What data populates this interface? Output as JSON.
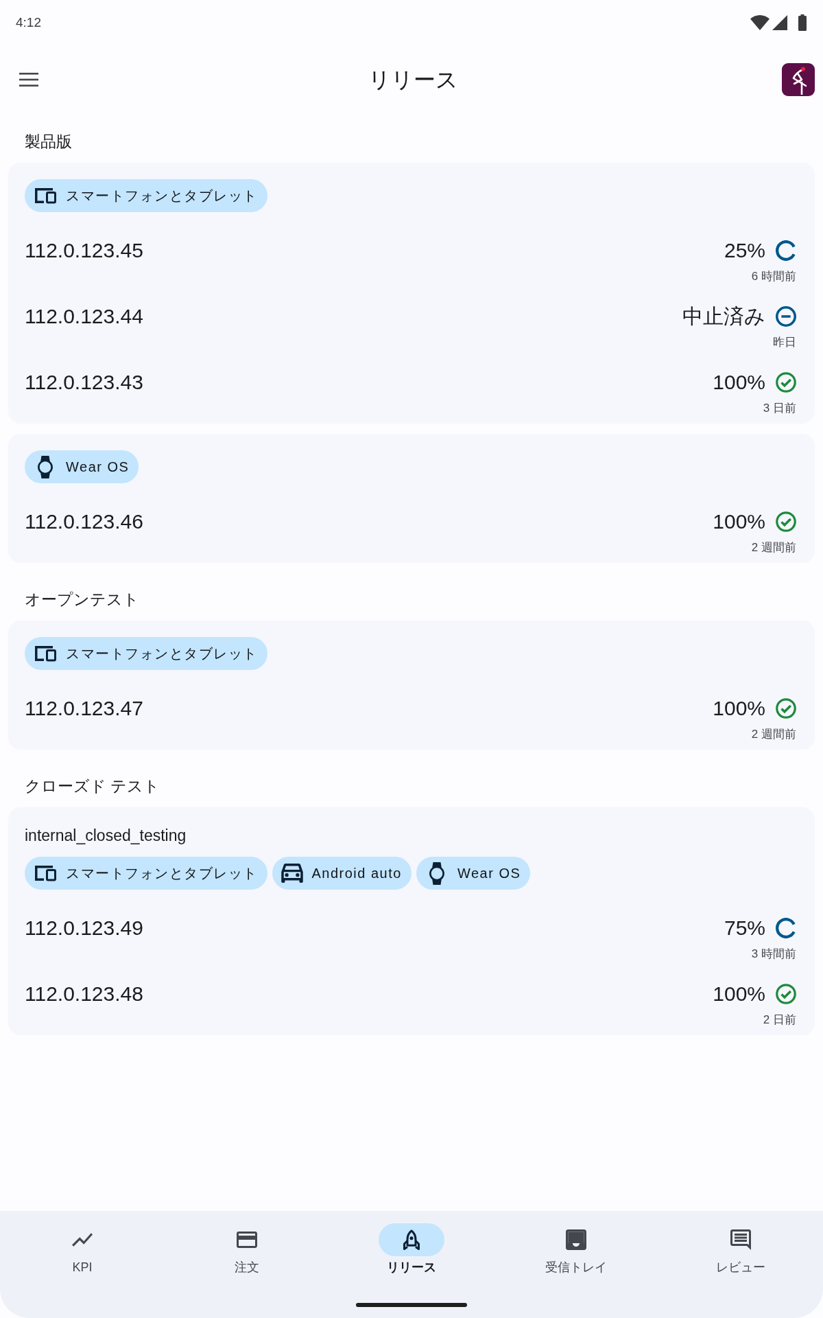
{
  "status_bar": {
    "time": "4:12"
  },
  "app_bar": {
    "title": "リリース"
  },
  "tracks": [
    {
      "title": "製品版",
      "groups": [
        {
          "form_factors": [
            {
              "kind": "phone_tablet",
              "label": "スマートフォンとタブレット"
            }
          ],
          "releases": [
            {
              "version": "112.0.123.45",
              "kind": "in_progress",
              "status": "25%",
              "time": "6 時間前"
            },
            {
              "version": "112.0.123.44",
              "kind": "halted",
              "status": "中止済み",
              "time": "昨日"
            },
            {
              "version": "112.0.123.43",
              "kind": "completed",
              "status": "100%",
              "time": "3 日前"
            }
          ]
        },
        {
          "form_factors": [
            {
              "kind": "watch",
              "label": "Wear OS"
            }
          ],
          "releases": [
            {
              "version": "112.0.123.46",
              "kind": "completed",
              "status": "100%",
              "time": "2 週間前"
            }
          ]
        }
      ]
    },
    {
      "title": "オープンテスト",
      "groups": [
        {
          "form_factors": [
            {
              "kind": "phone_tablet",
              "label": "スマートフォンとタブレット"
            }
          ],
          "releases": [
            {
              "version": "112.0.123.47",
              "kind": "completed",
              "status": "100%",
              "time": "2 週間前"
            }
          ]
        }
      ]
    },
    {
      "title": "クローズド テスト",
      "groups": [
        {
          "name": "internal_closed_testing",
          "form_factors": [
            {
              "kind": "phone_tablet",
              "label": "スマートフォンとタブレット"
            },
            {
              "kind": "car",
              "label": "Android auto"
            },
            {
              "kind": "watch",
              "label": "Wear OS"
            }
          ],
          "releases": [
            {
              "version": "112.0.123.49",
              "kind": "in_progress",
              "status": "75%",
              "time": "3 時間前"
            },
            {
              "version": "112.0.123.48",
              "kind": "completed",
              "status": "100%",
              "time": "2 日前"
            }
          ]
        }
      ]
    }
  ],
  "bottom_nav": [
    {
      "kind": "kpi",
      "label": "KPI",
      "selected": false
    },
    {
      "kind": "orders",
      "label": "注文",
      "selected": false
    },
    {
      "kind": "releases",
      "label": "リリース",
      "selected": true
    },
    {
      "kind": "inbox",
      "label": "受信トレイ",
      "selected": false
    },
    {
      "kind": "reviews",
      "label": "レビュー",
      "selected": false
    }
  ]
}
